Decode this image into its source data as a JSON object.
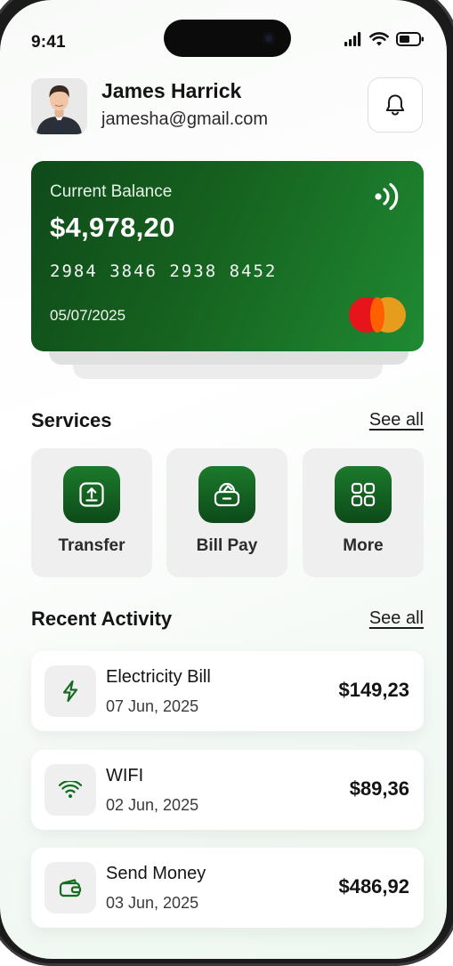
{
  "status_bar": {
    "time": "9:41"
  },
  "user": {
    "name": "James Harrick",
    "email": "jamesha@gmail.com"
  },
  "card": {
    "label": "Current Balance",
    "balance": "$4,978,20",
    "number": "2984 3846 2938 8452",
    "expiry": "05/07/2025"
  },
  "services": {
    "title": "Services",
    "see_all": "See all",
    "items": [
      {
        "label": "Transfer",
        "icon": "upload-icon"
      },
      {
        "label": "Bill Pay",
        "icon": "wallet-icon"
      },
      {
        "label": "More",
        "icon": "grid-icon"
      }
    ]
  },
  "activity": {
    "title": "Recent Activity",
    "see_all": "See all",
    "items": [
      {
        "title": "Electricity Bill",
        "date": "07 Jun, 2025",
        "amount": "$149,23",
        "icon": "lightning-icon"
      },
      {
        "title": "WIFI",
        "date": "02 Jun, 2025",
        "amount": "$89,36",
        "icon": "wifi-icon"
      },
      {
        "title": "Send Money",
        "date": "03 Jun, 2025",
        "amount": "$486,92",
        "icon": "wallet-icon"
      }
    ]
  },
  "colors": {
    "accent": "#16621f",
    "accent_light": "#1f8a33",
    "mastercard_red": "#e8141b",
    "mastercard_yellow": "#f79e1b"
  }
}
